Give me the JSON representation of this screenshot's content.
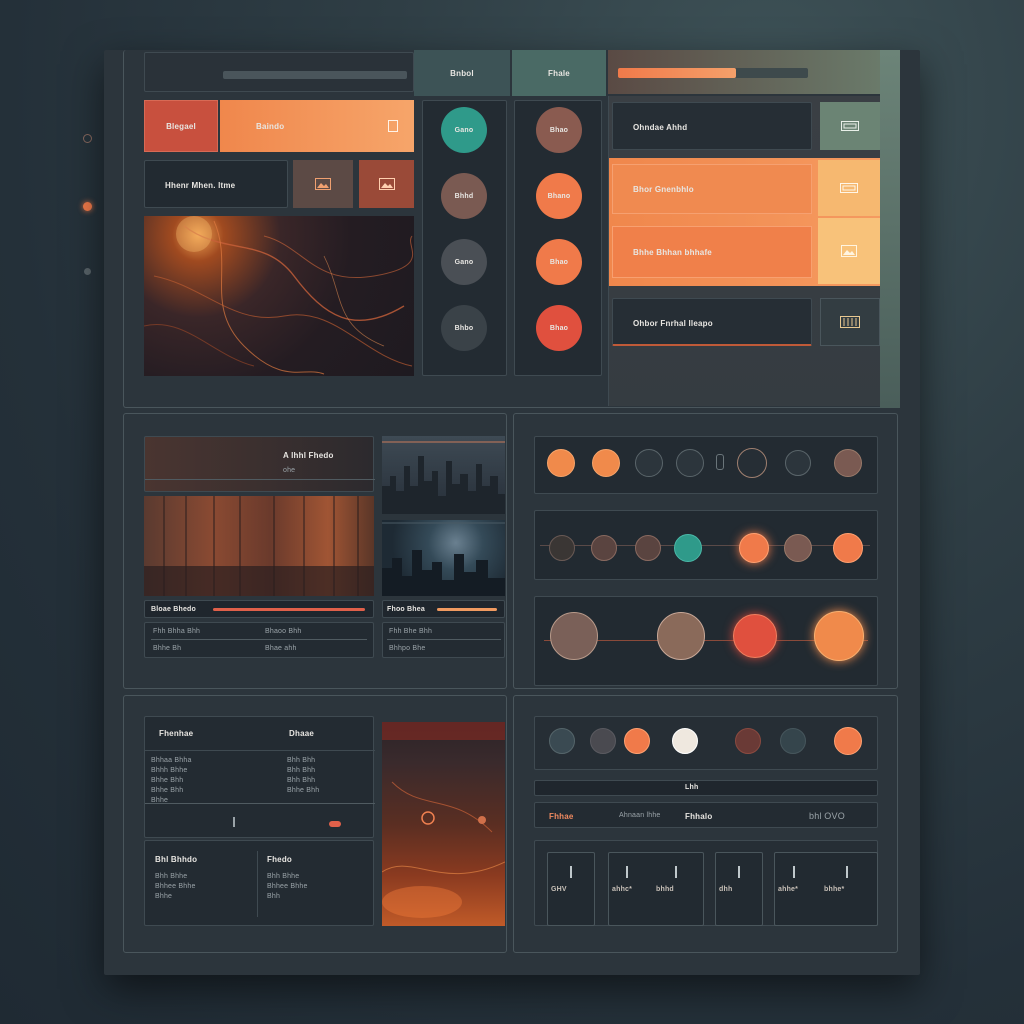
{
  "colors": {
    "orange": "#f08a4b",
    "orange_light": "#f5a06a",
    "red": "#d0473a",
    "teal": "#2e9a8a",
    "brown": "#8a5b50",
    "sand": "#f4c27a",
    "panel": "#2c353c",
    "card": "#262e35"
  },
  "top": {
    "header_tab_1": "Bnbol",
    "header_tab_2": "Fhale",
    "progress_fraction": 0.62
  },
  "left_top": {
    "red_chip": "Blegael",
    "orange_bar": "Baindo",
    "dark_row": "Hhenr Mhen. ltme",
    "image_icon_1": "image-icon",
    "image_icon_2": "image-icon"
  },
  "knobs_col_1": [
    "Gano",
    "Bhhd",
    "Gano",
    "Bhbo"
  ],
  "knobs_col_2": [
    "Bhao",
    "Bhano",
    "Bhao",
    "Bhao"
  ],
  "right_top": {
    "row1": "Ohndae Ahhd",
    "row2": "Bhor Gnenbhlo",
    "row3": "Bhhe Bhhan bhhafe",
    "row4": "Ohbor Fnrhal lleapo"
  },
  "media_left": {
    "header_title": "A lhhl Fhedo",
    "header_sub": "ohe",
    "caption_1": "Bloae Bhedo",
    "caption_2": "Fhoo Bhea",
    "meta_1": "Fhh Bhha   Bhh",
    "meta_2": "Bhaoo Bhh",
    "meta_3": "Bhhe Bh",
    "meta_4": "Bhae ahh",
    "meta_5": "Fhh Bhe   Bhh",
    "meta_6": "Bhhpo Bhe"
  },
  "bottom_left": {
    "title_left": "Fhenhae",
    "title_right": "Dhaae",
    "rows": [
      "Bhhaa Bhha",
      "Bhhh Bhhe",
      "Bhhe Bhh",
      "Bhhe Bhh",
      "Bhhe"
    ],
    "right_rows": [
      "Bhh Bhh",
      "Bhh Bhh",
      "Bhh Bhh",
      "Bhhe Bhh"
    ],
    "sub_title_1": "Bhl Bhhdo",
    "sub_title_2": "Fhedo",
    "sub_rows_1": [
      "Bhh Bhhe",
      "Bhhee Bhhe",
      "Bhhe"
    ],
    "sub_rows_2": [
      "Bhh Bhhe",
      "Bhhee Bhhe",
      "Bhh"
    ]
  },
  "bottom_right": {
    "label_bar": "Lhh",
    "row_left": "Fhhae",
    "row_mid": "Ahnaan lhhe",
    "row_right": "Fhhalo",
    "row_icons": "bhl  OVO",
    "tiles": [
      "GHV",
      "ahhc*",
      "bhhd",
      "dhh",
      "ahhe*",
      "bhhe*"
    ]
  }
}
